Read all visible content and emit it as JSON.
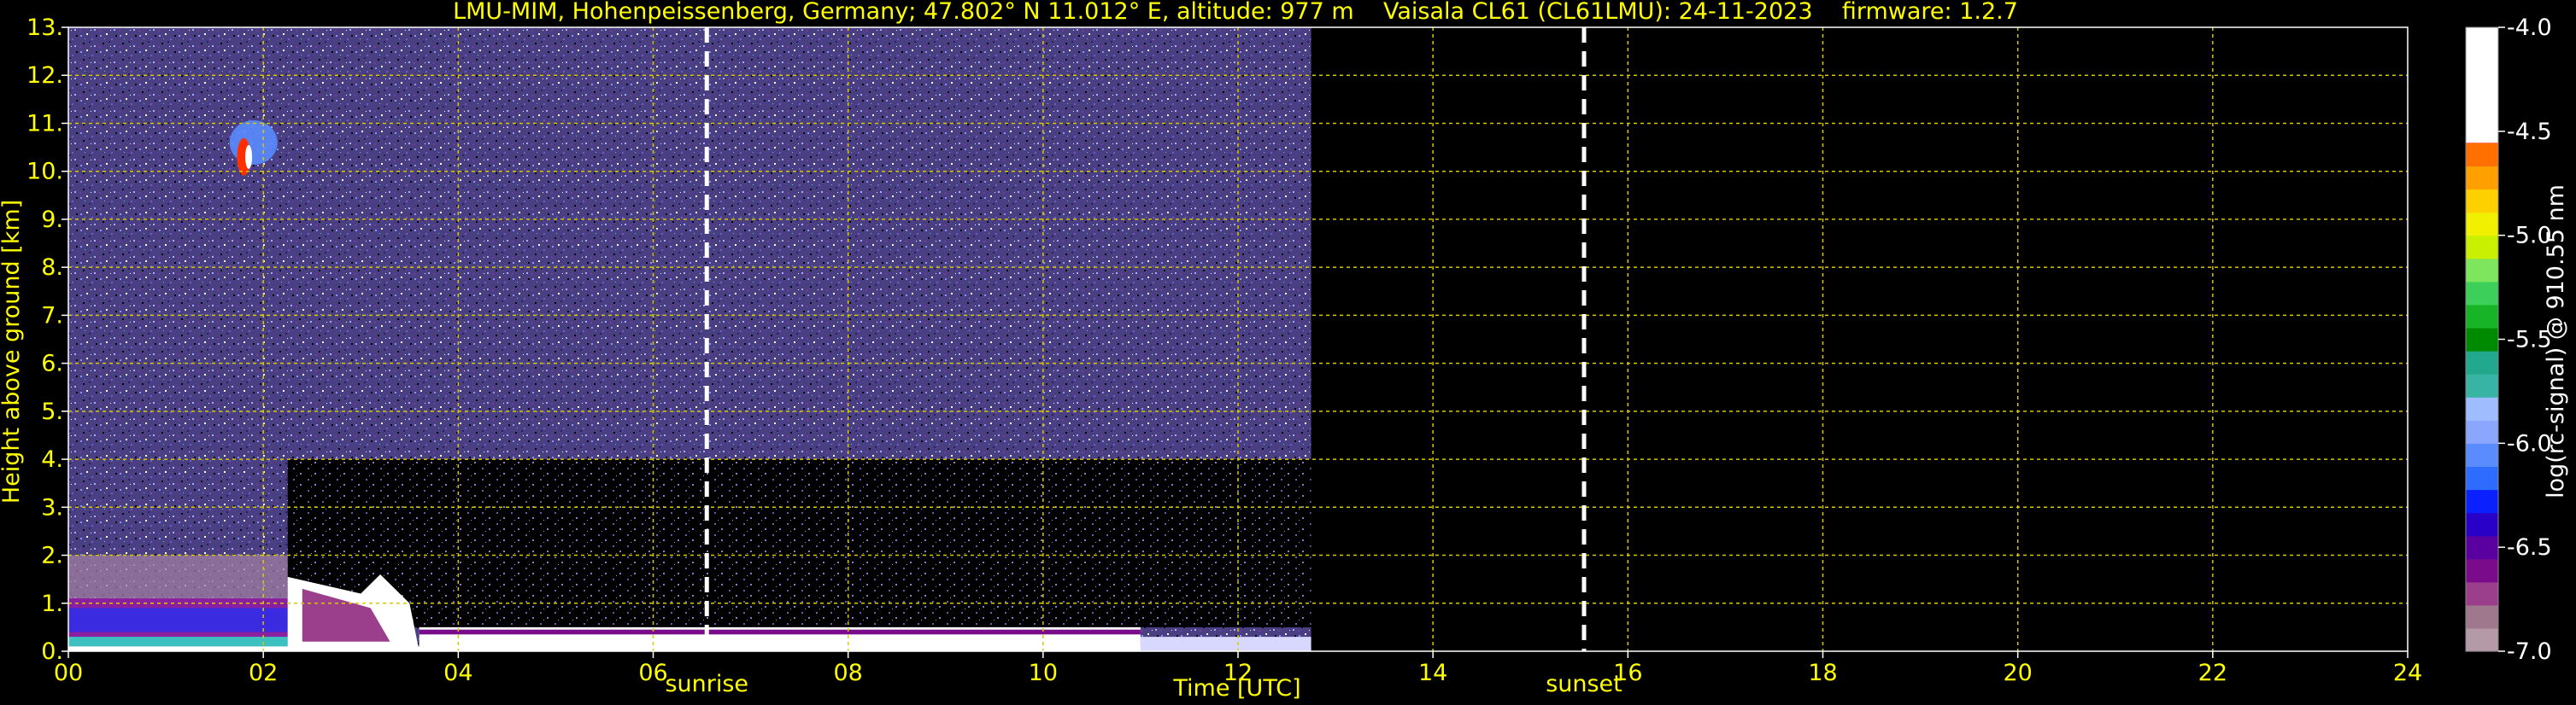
{
  "chart_data": {
    "type": "heatmap",
    "title": "LMU-MIM, Hohenpeissenberg, Germany; 47.802° N 11.012° E, altitude: 977 m    Vaisala CL61 (CL61LMU): 24-11-2023    firmware: 1.2.7",
    "xlabel": "Time [UTC]",
    "ylabel": "Height above ground [km]",
    "xlim": [
      0,
      24
    ],
    "ylim": [
      0,
      13
    ],
    "x_ticks": [
      "00",
      "02",
      "04",
      "06",
      "08",
      "10",
      "12",
      "14",
      "16",
      "18",
      "20",
      "22",
      "24"
    ],
    "y_ticks": [
      "0.",
      "1.",
      "2.",
      "3.",
      "4.",
      "5.",
      "6.",
      "7.",
      "8.",
      "9.",
      "10.",
      "11.",
      "12.",
      "13."
    ],
    "grid": true,
    "data_end_time": 12.75,
    "vertical_markers": [
      {
        "label": "sunrise",
        "time": 6.55
      },
      {
        "label": "sunset",
        "time": 15.55
      }
    ],
    "colorbar": {
      "label": "log(rc-signal) @ 910.55 nm",
      "range": [
        -7.0,
        -4.0
      ],
      "ticks": [
        "-4.0",
        "-4.5",
        "-5.0",
        "-5.5",
        "-6.0",
        "-6.5",
        "-7.0"
      ],
      "colors": [
        "#b49aa6",
        "#a0788e",
        "#9b3f8c",
        "#7a0b8a",
        "#5a00a0",
        "#2800c8",
        "#0a20ff",
        "#2e6cff",
        "#5a8cff",
        "#8aa6ff",
        "#9fbcff",
        "#38b4a4",
        "#22a88c",
        "#008a00",
        "#18b428",
        "#3cd05a",
        "#7ee65c",
        "#c8f000",
        "#f0f000",
        "#ffd000",
        "#ffa000",
        "#ff7000",
        "#ff3000",
        "#ff0000",
        "#ffa0a0",
        "#f0e0e0",
        "#ffffff"
      ]
    }
  }
}
